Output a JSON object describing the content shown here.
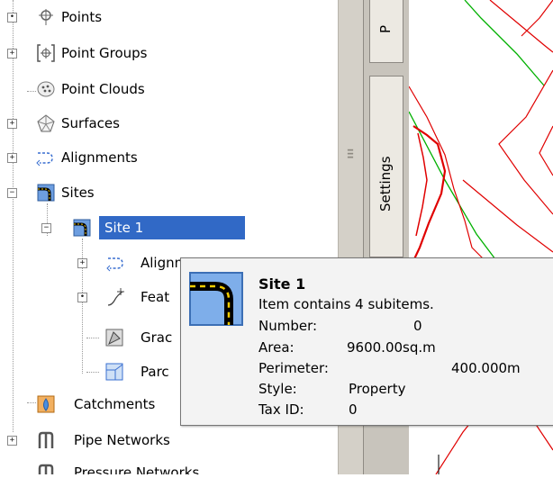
{
  "tree": {
    "points": "Points",
    "point_groups": "Point Groups",
    "point_clouds": "Point Clouds",
    "surfaces": "Surfaces",
    "alignments": "Alignments",
    "sites": "Sites",
    "site1": "Site 1",
    "site_alignments": "Alignments",
    "feature_lines": "Feat",
    "grading": "Grac",
    "parcels": "Parc",
    "catchments": "Catchments",
    "pipe_networks": "Pipe Networks",
    "pressure_networks": "Pressure Networks"
  },
  "tabs": {
    "settings": "Settings",
    "prospector": "P"
  },
  "tooltip": {
    "title": "Site 1",
    "subtitle": "Item contains 4 subitems.",
    "number_label": "Number:",
    "number_value": "0",
    "area_label": "Area:",
    "area_value": "9600.00sq.m",
    "perimeter_label": "Perimeter:",
    "perimeter_value": "400.000m",
    "style_label": "Style:",
    "style_value": "Property",
    "taxid_label": "Tax ID:",
    "taxid_value": "0"
  },
  "colors": {
    "selection": "#3169c6",
    "parcel_line": "#e00000",
    "alignment_line": "#00b000"
  }
}
